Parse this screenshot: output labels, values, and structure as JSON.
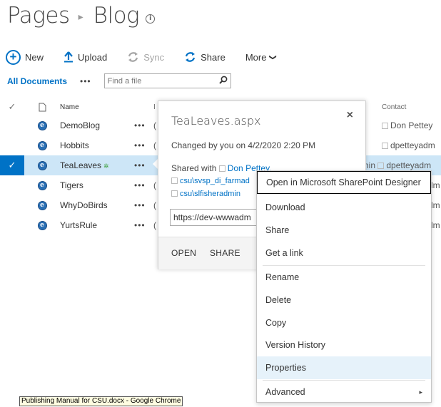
{
  "breadcrumb": {
    "parent": "Pages",
    "separator": "▸",
    "current": "Blog",
    "info_glyph": "i"
  },
  "toolbar": {
    "new_label": "New",
    "upload_label": "Upload",
    "sync_label": "Sync",
    "share_label": "Share",
    "more_label": "More",
    "more_caret": "❯"
  },
  "view": {
    "all_documents": "All Documents",
    "dots": "•••",
    "search_placeholder": "Find a file"
  },
  "list": {
    "header": {
      "name": "Name",
      "contact": "Contact",
      "truncated": "I"
    },
    "rows": [
      {
        "name": "DemoBlog",
        "dots": "•••",
        "trunc": "(",
        "contact": "Don Pettey",
        "selected": false,
        "is_new": false
      },
      {
        "name": "Hobbits",
        "dots": "•••",
        "trunc": "(",
        "contact": "dpetteyadm",
        "selected": false,
        "is_new": false
      },
      {
        "name": "TeaLeaves",
        "dots": "•••",
        "trunc": "",
        "contact": "dpetteyadm",
        "contact_prefix": "nin",
        "selected": true,
        "is_new": true
      },
      {
        "name": "Tigers",
        "dots": "•••",
        "trunc": "(",
        "contact": "dm",
        "selected": false,
        "is_new": false
      },
      {
        "name": "WhyDoBirds",
        "dots": "•••",
        "trunc": "(",
        "contact": "dm",
        "selected": false,
        "is_new": false
      },
      {
        "name": "YurtsRule",
        "dots": "•••",
        "trunc": "(",
        "contact": "dm",
        "selected": false,
        "is_new": false
      }
    ]
  },
  "callout": {
    "title": "TeaLeaves.aspx",
    "close": "×",
    "changed": "Changed by you on 4/2/2020 2:20 PM",
    "shared_with_label": "Shared with",
    "shared_user": "Don Pettey,",
    "shared_group1": "csu\\svsp_di_farmad",
    "shared_group2": "csu\\slfisheradmin",
    "url_value": "https://dev-wwwadm",
    "open_label": "OPEN",
    "share_label": "SHARE"
  },
  "menu": {
    "items": [
      {
        "label": "Open in Microsoft SharePoint Designer"
      },
      {
        "label": "Download"
      },
      {
        "label": "Share"
      },
      {
        "label": "Get a link"
      },
      {
        "label": "Rename"
      },
      {
        "label": "Delete"
      },
      {
        "label": "Copy"
      },
      {
        "label": "Version History"
      },
      {
        "label": "Properties"
      },
      {
        "label": "Advanced",
        "submenu_arrow": "▸"
      }
    ]
  },
  "tooltip": {
    "text": "Publishing Manual for CSU.docx - Google Chrome"
  },
  "colors": {
    "accent": "#0072c6",
    "selected_row": "#cde6f7",
    "menu_hover": "#e6f2fa",
    "tooltip_bg": "#fffde1"
  },
  "icons": [
    "plus-circle-icon",
    "upload-arrow-icon",
    "sync-icon",
    "share-icon",
    "search-icon",
    "checkmark-icon",
    "document-icon",
    "web-page-icon",
    "new-item-icon",
    "close-icon",
    "chevron-right-icon"
  ]
}
